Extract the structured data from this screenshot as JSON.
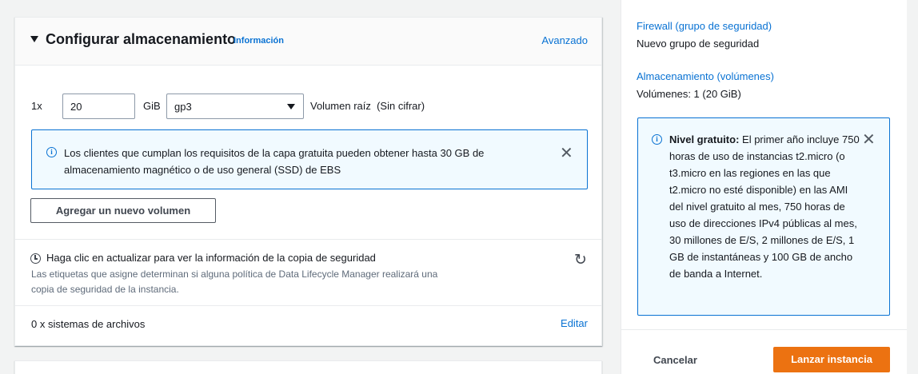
{
  "storage": {
    "title": "Configurar almacenamiento",
    "info_link": "Información",
    "advanced_link": "Avanzado",
    "volume": {
      "count_label": "1x",
      "size_value": "20",
      "unit_label": "GiB",
      "type_value": "gp3",
      "description": "Volumen raíz  (Sin cifrar)"
    },
    "alert_text": "Los clientes que cumplan los requisitos de la capa gratuita pueden obtener hasta 30 GB de almacenamiento magnético o de uso general (SSD) de EBS",
    "add_volume_button": "Agregar un nuevo volumen",
    "backup_title": "Haga clic en actualizar para ver la información de la copia de seguridad",
    "backup_description": "Las etiquetas que asigne determinan si alguna política de Data Lifecycle Manager realizará una copia de seguridad de la instancia.",
    "filesystems_label": "0 x sistemas de archivos",
    "edit_link": "Editar"
  },
  "summary": {
    "firewall_link": "Firewall (grupo de seguridad)",
    "firewall_value": "Nuevo grupo de seguridad",
    "storage_link": "Almacenamiento (volúmenes)",
    "storage_value": "Volúmenes: 1 (20 GiB)",
    "free_tier_title": "Nivel gratuito:",
    "free_tier_text": " El primer año incluye 750 horas de uso de instancias t2.micro (o t3.micro en las regiones en las que t2.micro no esté disponible) en las AMI del nivel gratuito al mes, 750 horas de uso de direcciones IPv4 públicas al mes, 30 millones de E/S, 2 millones de E/S, 1 GB de instantáneas y 100 GB de ancho de banda a Internet.",
    "cancel_button": "Cancelar",
    "launch_button": "Lanzar instancia"
  },
  "icons": {
    "info": "info-icon",
    "close": "close-icon",
    "refresh": "refresh-icon",
    "clock": "clock-icon",
    "caret": "caret-down-icon"
  },
  "colors": {
    "link": "#0972d3",
    "primary_button": "#ec7211",
    "info_background": "#f1faff"
  }
}
